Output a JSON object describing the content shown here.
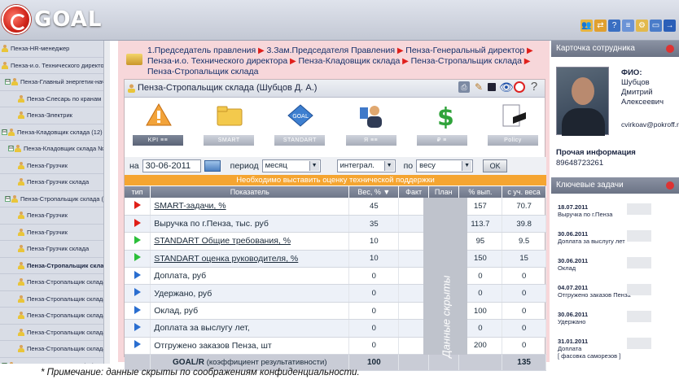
{
  "app": {
    "brand": "GOAL"
  },
  "tree": [
    {
      "label": "Пенза-HR-менеджер",
      "toggle": "",
      "indent": 0
    },
    {
      "label": "Пенза-и.о. Технического директор",
      "toggle": "",
      "indent": 0
    },
    {
      "label": "Пенза-Главный энергетик-началь",
      "toggle": "⊟",
      "indent": 4
    },
    {
      "label": "Пенза-Слесарь по кранам",
      "toggle": "",
      "indent": 20
    },
    {
      "label": "Пенза-Электрик",
      "toggle": "",
      "indent": 20
    },
    {
      "label": "Пенза-Кладовщик склада (12)",
      "toggle": "⊟",
      "indent": 0
    },
    {
      "label": "Пенза-Кладовщик склада №2 (",
      "toggle": "⊟",
      "indent": 8
    },
    {
      "label": "Пенза-Грузчик",
      "toggle": "",
      "indent": 20
    },
    {
      "label": "Пенза-Грузчик склада",
      "toggle": "",
      "indent": 20
    },
    {
      "label": "Пенза-Стропальщик склада (8",
      "toggle": "⊟",
      "indent": 4
    },
    {
      "label": "Пенза-Грузчик",
      "toggle": "",
      "indent": 20
    },
    {
      "label": "Пенза-Грузчик",
      "toggle": "",
      "indent": 20
    },
    {
      "label": "Пенза-Грузчик склада",
      "toggle": "",
      "indent": 20
    },
    {
      "label": "Пенза-Стропальщик склад",
      "toggle": "",
      "indent": 20,
      "active": true
    },
    {
      "label": "Пенза-Стропальщик склада",
      "toggle": "",
      "indent": 20
    },
    {
      "label": "Пенза-Стропальщик склада",
      "toggle": "",
      "indent": 20
    },
    {
      "label": "Пенза-Стропальщик склада",
      "toggle": "",
      "indent": 20
    },
    {
      "label": "Пенза-Стропальщик склада",
      "toggle": "",
      "indent": 20
    },
    {
      "label": "Пенза-Стропальщик склада",
      "toggle": "",
      "indent": 20
    },
    {
      "label": "Пенза-Начальник цеха (24)",
      "toggle": "⊟",
      "indent": 0
    }
  ],
  "breadcrumb": {
    "items": [
      "1.Председатель правления",
      "3.Зам.Председателя Правления",
      "Пенза-Генеральный директор",
      "Пенза-и.о. Технического директора",
      "Пенза-Кладовщик склада",
      "Пенза-Стропальщик склада",
      "Пенза-Стропальщик склада"
    ]
  },
  "panel": {
    "title": "Пенза-Стропальщик склада  (Шубцов Д. А.)",
    "help": "?"
  },
  "tabs": [
    {
      "label": "KPI  ≡≡",
      "icon": "kpi-icon",
      "active": true
    },
    {
      "label": "SMART",
      "icon": "folder-icon"
    },
    {
      "label": "STANDART",
      "icon": "standart-icon"
    },
    {
      "label": "Я  ≡≡",
      "icon": "person-icon"
    },
    {
      "label": "₽ ≡",
      "icon": "money-icon"
    },
    {
      "label": "Policy",
      "icon": "policy-icon"
    }
  ],
  "filter": {
    "date_label": "на",
    "date_value": "30-06-2011",
    "period_label": "период",
    "period_value": "месяц",
    "mode_value": "интеграл.",
    "by_label": "по",
    "by_value": "весу",
    "ok_label": "OK"
  },
  "banner": "Необходимо выставить оценку технической поддержки",
  "table": {
    "headers": [
      "тип",
      "Показатель",
      "Вес, % ▼",
      "Факт",
      "План",
      "% вып.",
      "с уч. веса"
    ],
    "rows": [
      {
        "color": "red",
        "name": "SMART-задачи, %",
        "underline": true,
        "weight": "45",
        "fact": "",
        "plan": "",
        "pct": "157",
        "weighted": "70.7"
      },
      {
        "color": "red",
        "name": "Выручка по г.Пенза, тыс. руб",
        "underline": false,
        "weight": "35",
        "fact": "",
        "plan": "",
        "pct": "113.7",
        "weighted": "39.8"
      },
      {
        "color": "green",
        "name": "STANDART Общие требования, %",
        "underline": true,
        "weight": "10",
        "fact": "",
        "plan": "",
        "pct": "95",
        "weighted": "9.5"
      },
      {
        "color": "green",
        "name": "STANDART оценка руководителя, %",
        "underline": true,
        "weight": "10",
        "fact": "",
        "plan": "",
        "pct": "150",
        "weighted": "15"
      },
      {
        "color": "blue",
        "name": "Доплата, руб",
        "underline": false,
        "weight": "0",
        "fact": "",
        "plan": "",
        "pct": "0",
        "weighted": "0"
      },
      {
        "color": "blue",
        "name": "Удержано, руб",
        "underline": false,
        "weight": "0",
        "fact": "",
        "plan": "",
        "pct": "0",
        "weighted": "0"
      },
      {
        "color": "blue",
        "name": "Оклад, руб",
        "underline": false,
        "weight": "0",
        "fact": "",
        "plan": "",
        "pct": "100",
        "weighted": "0"
      },
      {
        "color": "blue",
        "name": "Доплата за выслугу лет,",
        "underline": false,
        "weight": "0",
        "fact": "",
        "plan": "",
        "pct": "0",
        "weighted": "0"
      },
      {
        "color": "blue",
        "name": "Отгружено заказов Пенза, шт",
        "underline": false,
        "weight": "0",
        "fact": "",
        "plan": "",
        "pct": "200",
        "weighted": "0"
      }
    ],
    "total": {
      "label": "GOAL/R",
      "sub": "(коэффициент результативности)",
      "weight": "100",
      "weighted": "135"
    },
    "hidden_label": "Данные скрыты"
  },
  "card": {
    "title": "Карточка сотрудника",
    "fio_label": "ФИО:",
    "fio_value": "Шубцов Дмитрий Алексеевич",
    "email": "cvirkoav@pokroff.ru",
    "other_label": "Прочая информация",
    "phone": "89648723261"
  },
  "tasks": {
    "title": "Ключевые задачи",
    "items": [
      {
        "date": "18.07.2011",
        "text": "Выручка по г.Пенза"
      },
      {
        "date": "30.06.2011",
        "text": "Доплата за выслугу лет"
      },
      {
        "date": "30.06.2011",
        "text": "Оклад"
      },
      {
        "date": "04.07.2011",
        "text": "Отгружено заказов Пенза"
      },
      {
        "date": "30.06.2011",
        "text": "Удержано"
      },
      {
        "date": "31.01.2011",
        "text": "Доплата\n[ фасовка саморезов ]"
      }
    ]
  },
  "note": "* Примечание: данные скрыты по соображениям конфиденциальности."
}
